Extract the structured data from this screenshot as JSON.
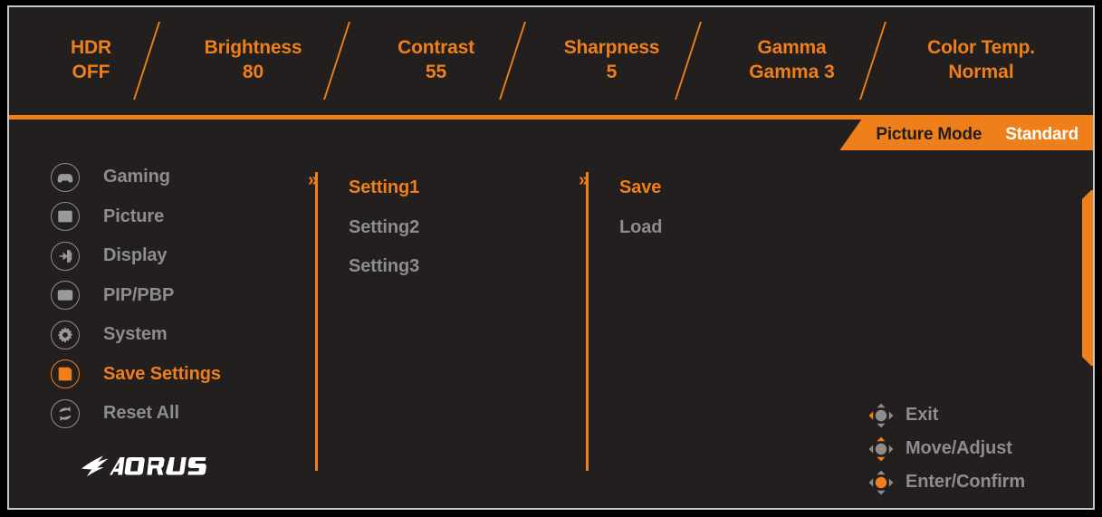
{
  "colors": {
    "accent": "#ef7f1a",
    "panel_bg": "#221f1e",
    "inactive_text": "#8d8d8d",
    "border": "#c9c9c9",
    "white": "#ffffff"
  },
  "statusbar": {
    "items": [
      {
        "label": "HDR",
        "value": "OFF"
      },
      {
        "label": "Brightness",
        "value": "80"
      },
      {
        "label": "Contrast",
        "value": "55"
      },
      {
        "label": "Sharpness",
        "value": "5"
      },
      {
        "label": "Gamma",
        "value": "Gamma 3"
      },
      {
        "label": "Color Temp.",
        "value": "Normal"
      }
    ]
  },
  "mode_tab": {
    "name": "Picture Mode",
    "value": "Standard"
  },
  "sidebar": {
    "items": [
      {
        "label": "Gaming",
        "icon": "gamepad-icon",
        "active": false
      },
      {
        "label": "Picture",
        "icon": "image-icon",
        "active": false
      },
      {
        "label": "Display",
        "icon": "input-icon",
        "active": false
      },
      {
        "label": "PIP/PBP",
        "icon": "pip-icon",
        "active": false
      },
      {
        "label": "System",
        "icon": "gear-icon",
        "active": false
      },
      {
        "label": "Save Settings",
        "icon": "floppy-icon",
        "active": true
      },
      {
        "label": "Reset All",
        "icon": "refresh-icon",
        "active": false
      }
    ],
    "logo_alt": "AORUS"
  },
  "column2": {
    "chevron": "»",
    "items": [
      {
        "label": "Setting1",
        "active": true
      },
      {
        "label": "Setting2",
        "active": false
      },
      {
        "label": "Setting3",
        "active": false
      }
    ]
  },
  "column3": {
    "chevron": "»",
    "items": [
      {
        "label": "Save",
        "active": true
      },
      {
        "label": "Load",
        "active": false
      }
    ]
  },
  "hints": {
    "items": [
      {
        "label": "Exit",
        "icon": "joystick-left-icon"
      },
      {
        "label": "Move/Adjust",
        "icon": "joystick-updown-icon"
      },
      {
        "label": "Enter/Confirm",
        "icon": "joystick-press-icon"
      }
    ]
  }
}
